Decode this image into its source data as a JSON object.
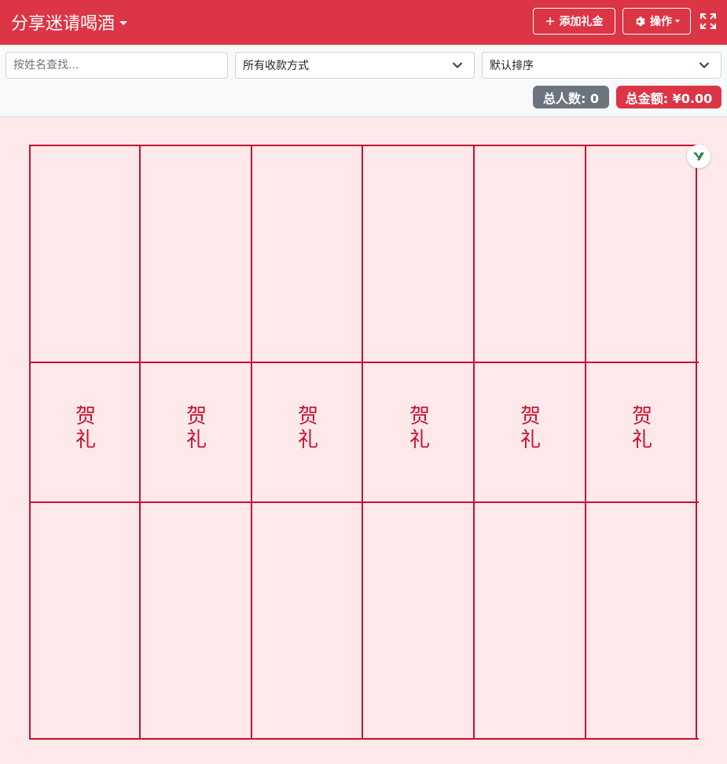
{
  "header": {
    "title": "分享迷请喝酒",
    "add_button_label": "添加礼金",
    "ops_button_label": "操作",
    "icons": {
      "add": "plus-icon",
      "ops": "gear-icon",
      "fullscreen": "fullscreen-icon",
      "title_menu": "caret-down-icon"
    }
  },
  "filters": {
    "search_placeholder": "按姓名查找...",
    "payment_method_selected": "所有收款方式",
    "sort_selected": "默认排序"
  },
  "stats": {
    "count_label": "总人数: 0",
    "total_label": "总金额: ¥0.00"
  },
  "gift_book": {
    "columns": [
      {
        "label": "贺礼"
      },
      {
        "label": "贺礼"
      },
      {
        "label": "贺礼"
      },
      {
        "label": "贺礼"
      },
      {
        "label": "贺礼"
      },
      {
        "label": "贺礼"
      }
    ]
  },
  "colors": {
    "brand_red": "#dc3545",
    "grid_red": "#c8102e",
    "page_background": "#fde8ea",
    "badge_gray": "#6c757d"
  }
}
